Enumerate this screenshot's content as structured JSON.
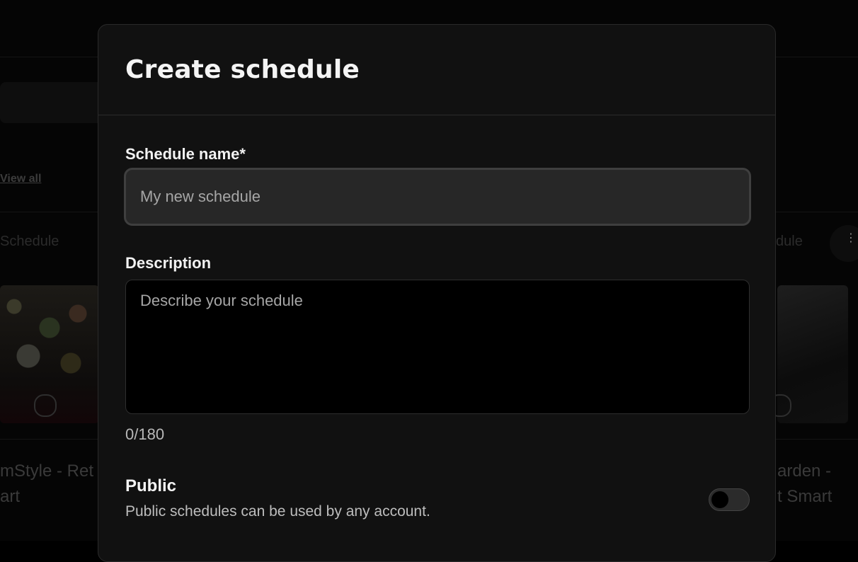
{
  "background": {
    "view_all": "View all",
    "card_left_label": "Schedule",
    "card_right_label": "dule",
    "card_left_title_line1": "mStyle - Ret",
    "card_left_title_line2": "art",
    "card_right_title_line1": "arden -",
    "card_right_title_line2": "t Smart",
    "more_dots": "⋮"
  },
  "modal": {
    "title": "Create schedule",
    "name_label": "Schedule name*",
    "name_placeholder": "My new schedule",
    "name_value": "",
    "description_label": "Description",
    "description_placeholder": "Describe your schedule",
    "description_value": "",
    "char_count": "0/180",
    "public_title": "Public",
    "public_description": "Public schedules can be used by any account.",
    "public_enabled": false
  },
  "colors": {
    "modal_bg": "#111111",
    "input_bg": "#272727",
    "textarea_bg": "#000000",
    "text_primary": "#f4f4f4",
    "text_secondary": "#bdbdbd",
    "placeholder": "#a6a6a6"
  }
}
